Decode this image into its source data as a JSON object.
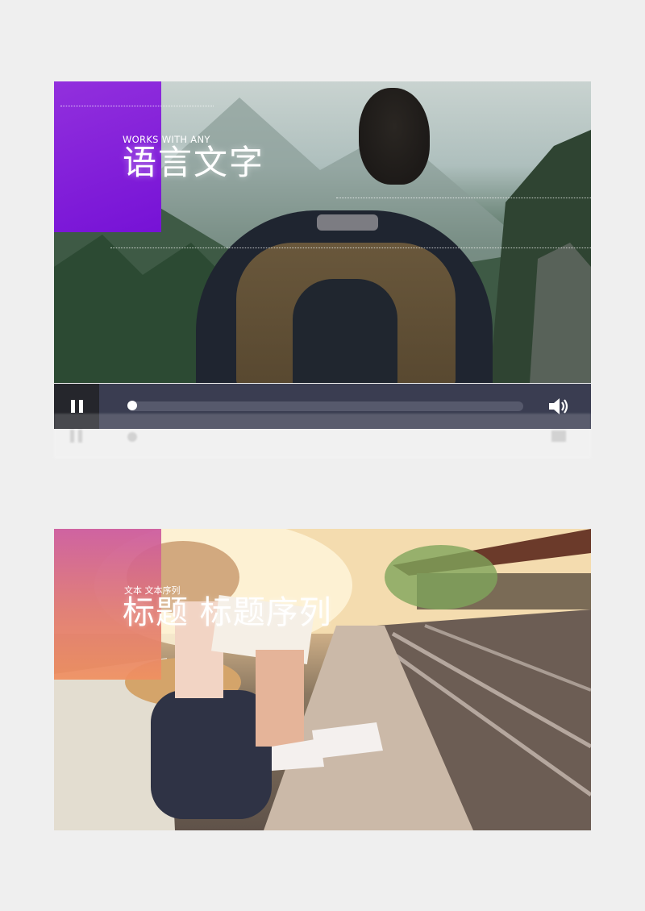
{
  "card1": {
    "eyebrow": "WORKS WITH ANY",
    "headline": "语言文字",
    "accent_color": "#8a22db"
  },
  "player": {
    "pause_icon": "pause-icon",
    "volume_icon": "volume-icon",
    "progress": 0.0
  },
  "card2": {
    "eyebrow": "文本 文本序列",
    "headline": "标题 标题序列",
    "accent_color": "#d96a88"
  }
}
